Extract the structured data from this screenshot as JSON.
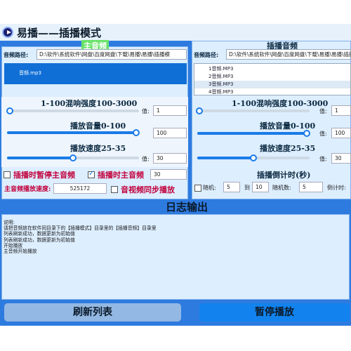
{
  "window": {
    "title": "易播——插播模式"
  },
  "main_audio": {
    "header": "主音频",
    "path_label": "音频路径:",
    "path_value": "D:\\软件\\系统软件\\网盘\\百度网盘\\下载\\易播\\易播\\插播模",
    "items": [
      "音频.mp3"
    ],
    "reverb": {
      "label": "1-100混响强度100-3000",
      "value_label": "值:",
      "value": "1",
      "level": 0.02
    },
    "volume": {
      "label": "播放音量0-100",
      "value": "100",
      "level": 1.0
    },
    "speed": {
      "label": "播放速度25-35",
      "value_label": "值:",
      "value": "30",
      "level": 0.5
    },
    "pause_main_label": "插播时暂停主音频",
    "pause_main_checked": false,
    "main_during_label": "插播时主音频",
    "main_during_checked": true,
    "main_during_value": "30",
    "main_speed_label": "主音频播放速度:",
    "main_speed_value": "525172",
    "sync_label": "音视频同步播放",
    "sync_checked": false
  },
  "insert_audio": {
    "header": "插播音频",
    "path_label": "音频路径:",
    "path_value": "D:\\软件\\系统软件\\网盘\\百度网盘\\下载\\易播\\易播\\插播模",
    "items": [
      "1音频.MP3",
      "2音频.MP3",
      "3音频.MP3",
      "4音频.MP3"
    ],
    "selected_index": 2,
    "reverb": {
      "label": "1-100混响强度100-3000",
      "value_label": "值:",
      "value": "1",
      "level": 0.02
    },
    "volume": {
      "label": "播放音量0-100",
      "value_label": "值:",
      "value": "100",
      "level": 1.0
    },
    "speed": {
      "label": "播放速度25-35",
      "value_label": "值:",
      "value": "30",
      "level": 0.5
    },
    "countdown_header": "插播倒计时(秒)",
    "random_label": "随机:",
    "random_checked": false,
    "random_from": "5",
    "to_label": "到",
    "random_to": "10",
    "random_count_label": "随机数:",
    "random_count": "5",
    "countdown_label": "倒计时:"
  },
  "log": {
    "header": "日志输出",
    "lines": [
      "说明:",
      "请把音频放在软件同目录下的【插播模式】目录里的【插播音频】目录里",
      "列表刷新成功，数据更新为初始值",
      "列表刷新成功，数据更新为初始值",
      "开始播放",
      "主音频开始播放"
    ]
  },
  "buttons": {
    "refresh": "刷新列表",
    "pause": "暂停播放"
  }
}
